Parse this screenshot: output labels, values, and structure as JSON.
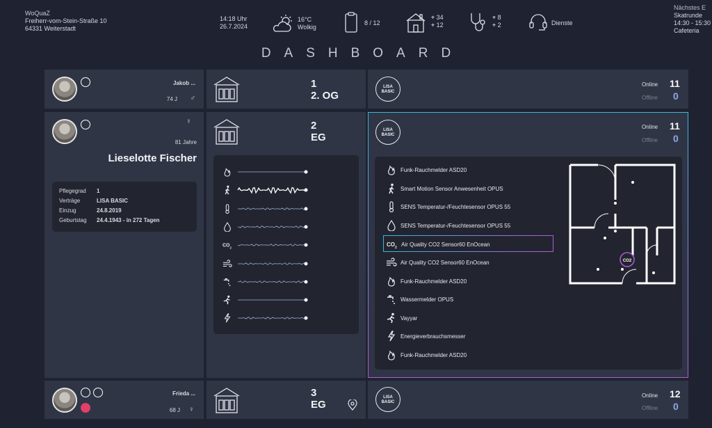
{
  "header": {
    "org_name": "WoQuaZ",
    "street": "Freiherr-vom-Stein-Straße 10",
    "city": "64331 Weiterstadt",
    "time": "14:18 Uhr",
    "date": "26.7.2024",
    "temperature": "16°C",
    "weather": "Wolkig",
    "occupancy": "8 / 12",
    "house_count_a": "34",
    "house_count_b": "12",
    "care_count_a": "8",
    "care_count_b": "2",
    "services_label": "Dienste",
    "next_event_title": "Nächstes E",
    "next_event_name": "Skatrunde",
    "next_event_time": "14:30 - 15:30",
    "next_event_place": "Cafeteria"
  },
  "page_title": "DASHBOARD",
  "residents": [
    {
      "name": "Jakob ...",
      "age": "74 J",
      "gender_icon": "male-icon"
    },
    {
      "name": "Lieselotte Fischer",
      "age": "81 Jahre",
      "gender_icon": "female-icon",
      "details": [
        {
          "label": "Pflegegrad",
          "value": "1"
        },
        {
          "label": "Verträge",
          "value": "LISA BASIC"
        },
        {
          "label": "Einzug",
          "value": "24.8.2019"
        },
        {
          "label": "Geburtstag",
          "value": "24.4.1943 - in 272 Tagen"
        }
      ]
    },
    {
      "name": "Frieda ...",
      "age": "68 J",
      "gender_icon": "female-icon"
    }
  ],
  "floors": [
    {
      "number": "1",
      "name": "2. OG"
    },
    {
      "number": "2",
      "name": "EG"
    },
    {
      "number": "3",
      "name": "EG"
    }
  ],
  "sensor_rows": [
    "flame-icon",
    "walking-person-icon",
    "thermometer-icon",
    "droplet-icon",
    "co2-icon",
    "wind-icon",
    "water-tap-icon",
    "fall-person-icon",
    "lightning-icon"
  ],
  "lisa": {
    "logo_line1": "LISA",
    "logo_line2": "BASIC",
    "online_label": "Online",
    "offline_label": "Offline",
    "status": [
      {
        "online": "11",
        "offline": "0"
      },
      {
        "online": "11",
        "offline": "0"
      },
      {
        "online": "12",
        "offline": "0"
      }
    ]
  },
  "devices": [
    {
      "label": "Funk-Rauchmelder ASD20",
      "icon": "flame-icon"
    },
    {
      "label": "Smart Motion Sensor Anwesenheit OPUS",
      "icon": "walking-person-icon"
    },
    {
      "label": "SENS Temperatur-/Feuchtesensor OPUS 55",
      "icon": "thermometer-icon"
    },
    {
      "label": "SENS Temperatur-/Feuchtesensor OPUS 55",
      "icon": "droplet-icon"
    },
    {
      "label": "Air Quality CO2 Sensor60 EnOcean",
      "icon": "co2-icon",
      "selected": true
    },
    {
      "label": "Air Quality CO2 Sensor60 EnOcean",
      "icon": "wind-icon"
    },
    {
      "label": "Funk-Rauchmelder ASD20",
      "icon": "flame-icon"
    },
    {
      "label": "Wassermelder OPUS",
      "icon": "water-tap-icon"
    },
    {
      "label": "Vayyar",
      "icon": "fall-person-icon"
    },
    {
      "label": "Energieverbrauchsmesser",
      "icon": "lightning-icon"
    },
    {
      "label": "Funk-Rauchmelder ASD20",
      "icon": "flame-icon"
    }
  ],
  "floorplan_co2_label": "CO2",
  "colors": {
    "background": "#1f2230",
    "panel": "#303545",
    "inner": "#22252f",
    "accent_cyan": "#39b8d8",
    "accent_magenta": "#b05ad8",
    "offline_count": "#8fa7e8"
  }
}
